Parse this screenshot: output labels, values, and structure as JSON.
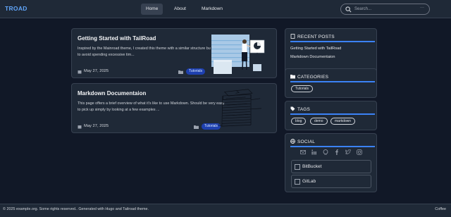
{
  "nav": {
    "brand": "TROAD",
    "links": [
      {
        "label": "Home",
        "active": true
      },
      {
        "label": "About",
        "active": false
      },
      {
        "label": "Markdown",
        "active": false
      }
    ],
    "search_placeholder": "Search...",
    "search_more": "···"
  },
  "posts": [
    {
      "title": "Getting Started with TailRoad",
      "excerpt": "Inspired by the Mainroad theme, I created this theme with a similar structure but wanted to avoid spending excessive tim...",
      "date": "May 27, 2025",
      "category": "Tutorials",
      "image": "woman-presenting-illustration"
    },
    {
      "title": "Markdown Documentaion",
      "excerpt": "This page offers a brief overview of what it's like to use Markdown. Should be very easy to pick up simply by looking at a few examples ...",
      "date": "May 27, 2025",
      "category": "Tutorials",
      "image": "paper-stack-sketch"
    }
  ],
  "sidebar": {
    "recent": {
      "heading": "RECENT POSTS",
      "items": [
        "Getting Started with TailRoad",
        "Markdown Documentaion"
      ]
    },
    "categories": {
      "heading": "CATEGORIES",
      "items": [
        "Tutorials"
      ]
    },
    "tags": {
      "heading": "TAGS",
      "items": [
        "blog",
        "demo",
        "markdown"
      ]
    },
    "social": {
      "heading": "SOCIAL",
      "icons": [
        "mail-icon",
        "linkedin-icon",
        "github-icon",
        "facebook-icon",
        "twitter-icon",
        "instagram-icon"
      ],
      "buttons": [
        "BitBucket",
        "GitLab"
      ]
    }
  },
  "footer": {
    "copyright": "© 2025 example.org. Some rights reserved.. Generated with Hugo and Tailroad theme.",
    "right": "Coffee"
  },
  "colors": {
    "background": "#111827",
    "panel": "#1f2937",
    "accent": "#3b82f6",
    "brand": "#60a5fa",
    "badge": "#1e40af"
  }
}
